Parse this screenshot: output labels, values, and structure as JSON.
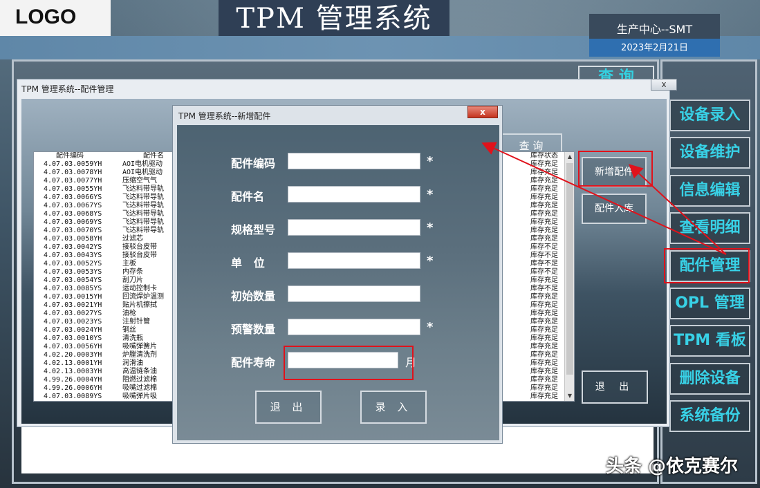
{
  "header": {
    "logo": "LOGO",
    "app_title": "TPM 管理系统",
    "department": "生产中心--SMT",
    "date": "2023年2月21日"
  },
  "main": {
    "query_label": "查 询"
  },
  "sidebar": {
    "items": [
      {
        "label": "设备录入"
      },
      {
        "label": "设备维护"
      },
      {
        "label": "信息编辑"
      },
      {
        "label": "查看明细"
      },
      {
        "label": "配件管理"
      },
      {
        "label": "OPL 管理"
      },
      {
        "label": "TPM 看板"
      },
      {
        "label": "删除设备"
      },
      {
        "label": "系统备份"
      }
    ]
  },
  "parts_window": {
    "title": "TPM 管理系统--配件管理",
    "close": "x",
    "query_label": "查 询",
    "columns": [
      "配件编码",
      "配件名",
      "库存状态"
    ],
    "rows": [
      {
        "code": "4.07.03.0059YH",
        "name": "AOI电机驱动",
        "status": "库存充足"
      },
      {
        "code": "4.07.03.0078YH",
        "name": "AOI电机驱动",
        "status": "库存充足"
      },
      {
        "code": "4.07.03.0077YH",
        "name": "压缩空气气",
        "status": "库存充足"
      },
      {
        "code": "4.07.03.0055YH",
        "name": "飞达料带导轨",
        "status": "库存充足"
      },
      {
        "code": "4.07.03.0066YS",
        "name": "飞达料带导轨",
        "status": "库存充足"
      },
      {
        "code": "4.07.03.0067YS",
        "name": "飞达料带导轨",
        "status": "库存充足"
      },
      {
        "code": "4.07.03.0068YS",
        "name": "飞达料带导轨",
        "status": "库存充足"
      },
      {
        "code": "4.07.03.0069YS",
        "name": "飞达料带导轨",
        "status": "库存充足"
      },
      {
        "code": "4.07.03.0070YS",
        "name": "飞达料带导轨",
        "status": "库存充足"
      },
      {
        "code": "4.07.03.0058YH",
        "name": "过滤芯",
        "status": "库存充足"
      },
      {
        "code": "4.07.03.0042YS",
        "name": "接驳台皮带",
        "status": "库存不足"
      },
      {
        "code": "4.07.03.0043YS",
        "name": "接驳台皮带",
        "status": "库存不足"
      },
      {
        "code": "4.07.03.0052YS",
        "name": "主板",
        "status": "库存不足"
      },
      {
        "code": "4.07.03.0053YS",
        "name": "内存条",
        "status": "库存不足"
      },
      {
        "code": "4.07.03.0054YS",
        "name": "刮刀片",
        "status": "库存充足"
      },
      {
        "code": "4.07.03.0085YS",
        "name": "运动控制卡",
        "status": "库存不足"
      },
      {
        "code": "4.07.03.0015YH",
        "name": "回流焊炉温测",
        "status": "库存充足"
      },
      {
        "code": "4.07.03.0021YH",
        "name": "贴片机擦拭",
        "status": "库存充足"
      },
      {
        "code": "4.07.03.0027YS",
        "name": "油枪",
        "status": "库存充足"
      },
      {
        "code": "4.07.03.0023YS",
        "name": "注射针管",
        "status": "库存充足"
      },
      {
        "code": "4.07.03.0024YH",
        "name": "钢丝",
        "status": "库存充足"
      },
      {
        "code": "4.07.03.0010YS",
        "name": "清洗瓶",
        "status": "库存充足"
      },
      {
        "code": "4.07.03.0056YH",
        "name": "吸嘴弹簧片",
        "status": "库存充足"
      },
      {
        "code": "4.02.20.0003YH",
        "name": "炉膛清洗剂",
        "status": "库存充足"
      },
      {
        "code": "4.02.13.0001YH",
        "name": "润滑油",
        "status": "库存充足"
      },
      {
        "code": "4.02.13.0003YH",
        "name": "高温链条油",
        "status": "库存充足"
      },
      {
        "code": "4.99.26.0004YH",
        "name": "阻燃过滤棉",
        "status": "库存充足"
      },
      {
        "code": "4.99.26.0006YH",
        "name": "吸嘴过滤棉",
        "status": "库存充足"
      },
      {
        "code": "4.07.03.0089YS",
        "name": "吸嘴弹片吸",
        "status": "库存充足"
      }
    ],
    "add_part": "新增配件",
    "stock_in": "配件入库",
    "exit": "退 出"
  },
  "add_dialog": {
    "title": "TPM 管理系统--新增配件",
    "close": "x",
    "fields": [
      {
        "label": "配件编码",
        "value": "",
        "required": "*"
      },
      {
        "label": "配件名",
        "value": "",
        "required": "*"
      },
      {
        "label": "规格型号",
        "value": "",
        "required": "*"
      },
      {
        "label": "单   位",
        "value": "",
        "required": "*"
      },
      {
        "label": "初始数量",
        "value": "",
        "required": ""
      },
      {
        "label": "预警数量",
        "value": "",
        "required": "*"
      },
      {
        "label": "配件寿命",
        "value": "",
        "required": ""
      }
    ],
    "life_unit": "月",
    "exit": "退 出",
    "submit": "录 入"
  },
  "watermark": {
    "text": "头条 @依克赛尔",
    "small": "@依克赛尔"
  },
  "colors": {
    "accent_cyan": "#38d1e6",
    "highlight_red": "#e0121b",
    "date_blue": "#2f6fb0"
  }
}
